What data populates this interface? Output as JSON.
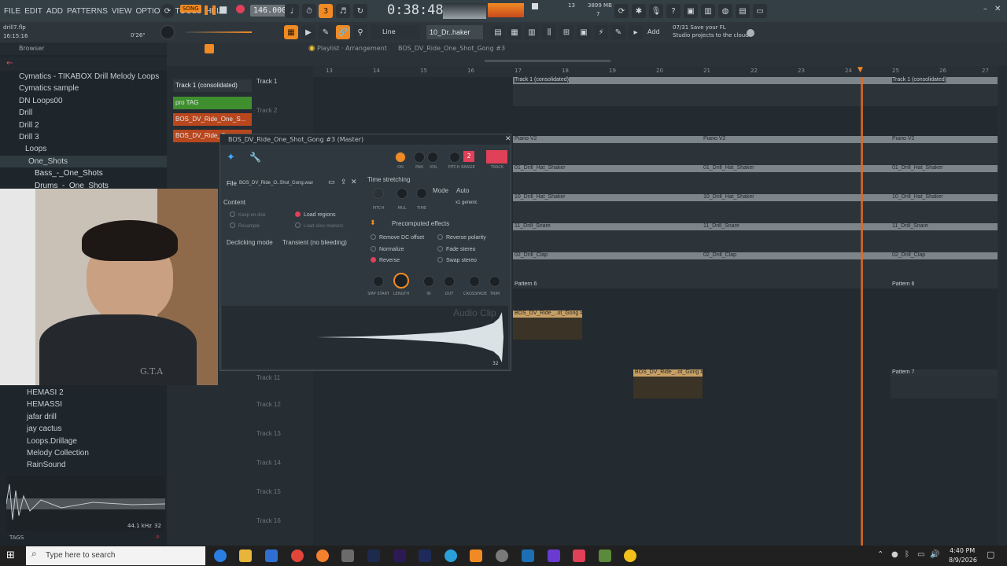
{
  "menu": [
    "FILE",
    "EDIT",
    "ADD",
    "PATTERNS",
    "VIEW",
    "OPTIONS",
    "TOOLS",
    "HELP"
  ],
  "transport": {
    "song_badge": "SONG",
    "tempo": "146.000",
    "time": "0:38:48",
    "cpu": "13",
    "memory": "3899 MB",
    "voices": "7"
  },
  "project": {
    "file": "drill7.flp",
    "timestamp": "16:15:16",
    "pos": "0'26\""
  },
  "pattern_selector": "10_Dr..haker",
  "snap_mode": "Line",
  "add_label": "Add",
  "hint": {
    "line1": "07/31  Save your FL",
    "line2": "Studio projects to the cloud"
  },
  "browser": {
    "title": "Browser",
    "items": [
      {
        "label": "Cymatics - TIKABOX Drill Melody Loops"
      },
      {
        "label": "Cymatics sample"
      },
      {
        "label": "DN Loops00"
      },
      {
        "label": "Drill"
      },
      {
        "label": "Drill 2"
      },
      {
        "label": "Drill 3"
      },
      {
        "label": "Loops"
      },
      {
        "label": "One_Shots"
      },
      {
        "label": "Bass_-_One_Shots"
      },
      {
        "label": "Drums_-_One_Shots"
      }
    ],
    "items_bottom": [
      {
        "label": "HEMASI 2"
      },
      {
        "label": "HEMASSI"
      },
      {
        "label": "jafar drill"
      },
      {
        "label": "jay cactus"
      },
      {
        "label": "Loops.Drillage"
      },
      {
        "label": "Melody Collection"
      },
      {
        "label": "RainSound"
      }
    ],
    "sample_rate": "44.1 kHz",
    "bits": "32",
    "tags_label": "TAGS"
  },
  "playlist": {
    "breadcrumb": "Playlist · Arrangement",
    "clip_name": "BOS_DV_Ride_One_Shot_Gong #3",
    "ruler": [
      "13",
      "14",
      "15",
      "16",
      "17",
      "18",
      "19",
      "20",
      "21",
      "22",
      "23",
      "24",
      "25",
      "26",
      "27"
    ],
    "track_names": [
      "Track 1",
      "Track 2",
      "Track 11",
      "Track 12",
      "Track 13",
      "Track 14",
      "Track 15",
      "Track 16"
    ],
    "picker": [
      "Track 1 (consolidated)",
      "pro TAG",
      "BOS_DV_Ride_One_S...",
      "BOS_DV_Ride_On..."
    ],
    "clips": [
      {
        "label": "Track 1 (consolidated)"
      },
      {
        "label": "Track 1 (consolidated)"
      },
      {
        "label": "Piano V2"
      },
      {
        "label": "Piano V2"
      },
      {
        "label": "Piano V2"
      },
      {
        "label": "01_Drill_Hat_Shaker"
      },
      {
        "label": "01_Drill_Hat_Shaker"
      },
      {
        "label": "01_Drill_Hat_Shaker"
      },
      {
        "label": "10_Drill_Hat_Shaker"
      },
      {
        "label": "10_Drill_Hat_Shaker"
      },
      {
        "label": "10_Drill_Hat_Shaker"
      },
      {
        "label": "11_Drill_Snare"
      },
      {
        "label": "11_Drill_Snare"
      },
      {
        "label": "11_Drill_Snare"
      },
      {
        "label": "02_Drill_Clap"
      },
      {
        "label": "02_Drill_Clap"
      },
      {
        "label": "02_Drill_Clap"
      },
      {
        "label": "Pattern 6"
      },
      {
        "label": "Pattern 6"
      },
      {
        "label": "BOS_DV_Ride_..ot_Gong #2"
      },
      {
        "label": "BOS_DV_Ride_..ot_Gong #3"
      },
      {
        "label": "Pattern 7"
      }
    ]
  },
  "channel_settings": {
    "title": "BOS_DV_Ride_One_Shot_Gong #3 (Master)",
    "knob_labels": [
      "ON",
      "PAN",
      "VOL",
      "PITCH",
      "RANGE",
      "TRACK"
    ],
    "range_value": "2",
    "file_label": "File",
    "file_name": "BOS_DV_Ride_O..Shot_Gong.wav",
    "content_label": "Content",
    "keep_on_disk": "Keep on disk",
    "resample": "Resample",
    "load_regions": "Load regions",
    "load_slice_markers": "Load slice markers",
    "declicking_label": "Declicking mode",
    "declicking_value": "Transient (no bleeding)",
    "time_stretching": "Time stretching",
    "mode_label": "Mode",
    "mode_value": "Auto",
    "ts_knobs": [
      "PITCH",
      "MUL",
      "TIME"
    ],
    "ts_value": "x1 generic",
    "precomputed": "Precomputed effects",
    "effects": [
      "Remove DC offset",
      "Reverse polarity",
      "Normalize",
      "Fade stereo",
      "Reverse",
      "Swap stereo"
    ],
    "fx_knobs": [
      "SMP START",
      "LENGTH",
      "IN",
      "OUT",
      "CROSSFADE",
      "TRIM"
    ],
    "watermark": "Audio Clip",
    "page": "32"
  },
  "webcam_shirt": "G.T.A",
  "taskbar": {
    "search_placeholder": "Type here to search",
    "time": "4:40 PM",
    "date": "8/9/2026"
  },
  "colors": {
    "accent": "#f08a24",
    "recording": "#e04058",
    "clip_header": "#7c858a",
    "playhead": "#e06a1e"
  }
}
